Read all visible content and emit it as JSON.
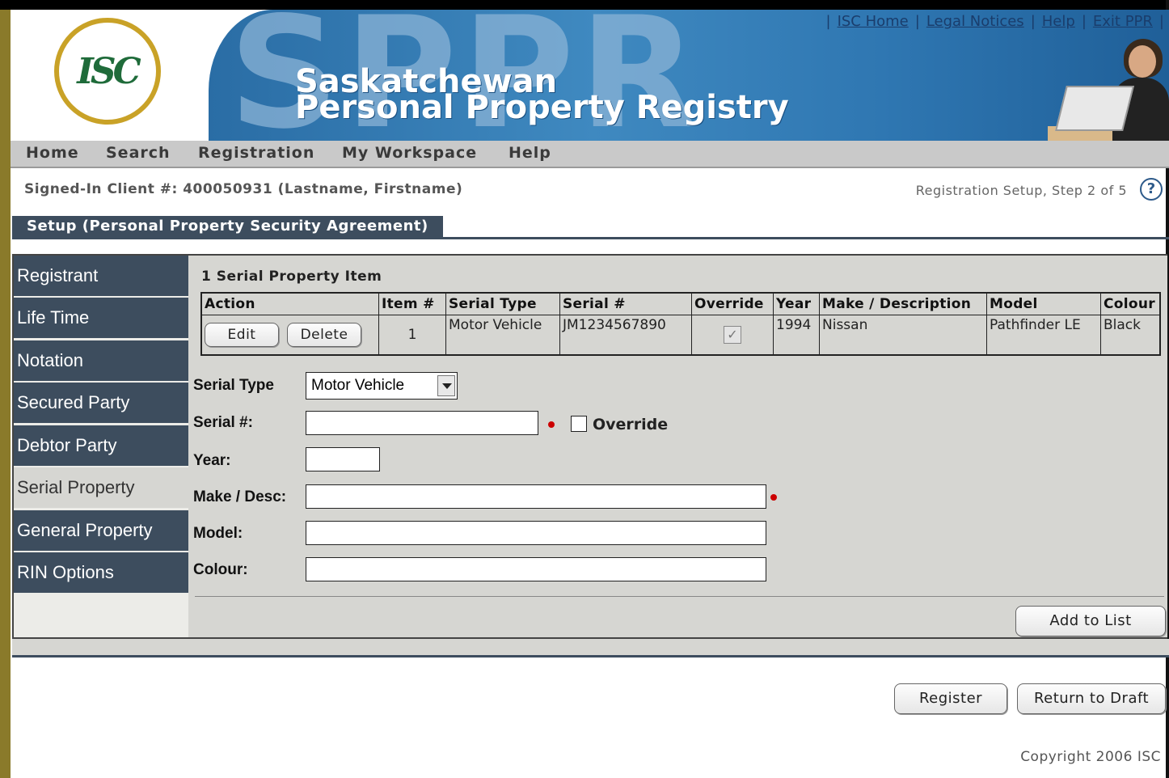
{
  "header": {
    "logo_text": "ISC",
    "big_letters": "SPPR",
    "title_line1": "Saskatchewan",
    "title_line2": "Personal Property Registry",
    "links": [
      "ISC Home",
      "Legal Notices",
      "Help",
      "Exit PPR"
    ]
  },
  "nav": {
    "items": [
      "Home",
      "Search",
      "Registration",
      "My Workspace",
      "Help"
    ]
  },
  "signin": "Signed-In Client #: 400050931 (Lastname, Firstname)",
  "step": "Registration Setup, Step 2 of 5",
  "help_icon": "?",
  "setup_tab": "Setup (Personal Property Security Agreement)",
  "sidebar": {
    "items": [
      "Registrant",
      "Life Time",
      "Notation",
      "Secured Party",
      "Debtor Party",
      "Serial Property",
      "General Property",
      "RIN Options"
    ],
    "active": "Serial Property"
  },
  "items_title": "1 Serial Property Item",
  "table": {
    "headers": [
      "Action",
      "Item #",
      "Serial Type",
      "Serial #",
      "Override",
      "Year",
      "Make / Description",
      "Model",
      "Colour"
    ],
    "edit_label": "Edit",
    "delete_label": "Delete",
    "rows": [
      {
        "item": "1",
        "serial_type": "Motor Vehicle",
        "serial": "JM1234567890",
        "override": true,
        "year": "1994",
        "make": "Nissan",
        "model": "Pathfinder LE",
        "colour": "Black"
      }
    ]
  },
  "form": {
    "serial_type_label": "Serial Type",
    "serial_type_value": "Motor Vehicle",
    "serial_label": "Serial #:",
    "override_label": "Override",
    "year_label": "Year:",
    "make_label": "Make / Desc:",
    "model_label": "Model:",
    "colour_label": "Colour:",
    "serial_value": "",
    "year_value": "",
    "make_value": "",
    "model_value": "",
    "colour_value": "",
    "add_label": "Add to List"
  },
  "footer": {
    "register_label": "Register",
    "return_label": "Return to Draft",
    "copyright": "Copyright 2006 ISC"
  },
  "colors": {
    "nav_dark": "#3d4d5e",
    "banner_blue": "#2f77b2",
    "logo_green": "#1f6b3a",
    "logo_gold": "#c9a227",
    "required": "#cc0000"
  }
}
